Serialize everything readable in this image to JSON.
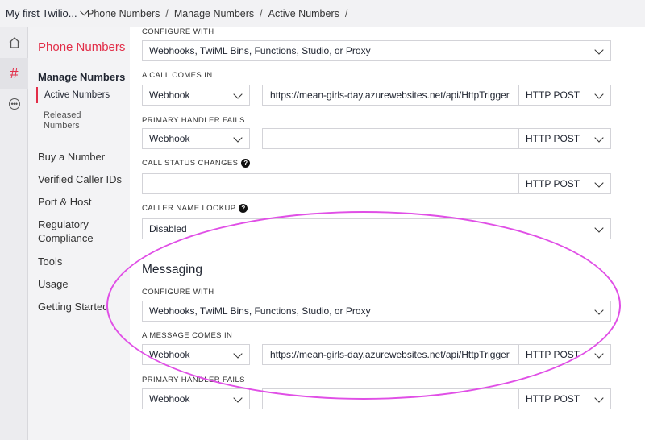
{
  "topbar": {
    "account_label": "My first Twilio...",
    "breadcrumbs": [
      "Phone Numbers",
      "Manage Numbers",
      "Active Numbers"
    ],
    "separator": "/"
  },
  "rail": {
    "icons": [
      "home-icon",
      "hash-icon",
      "more-icon"
    ]
  },
  "sidenav": {
    "title": "Phone Numbers",
    "manage": "Manage Numbers",
    "active": "Active Numbers",
    "released": "Released Numbers",
    "items": [
      "Buy a Number",
      "Verified Caller IDs",
      "Port & Host",
      "Regulatory Compliance",
      "Tools",
      "Usage",
      "Getting Started"
    ]
  },
  "voice": {
    "configure_label": "CONFIGURE WITH",
    "configure_value": "Webhooks, TwiML Bins, Functions, Studio, or Proxy",
    "call_comes_in_label": "A CALL COMES IN",
    "call_comes_in_type": "Webhook",
    "call_comes_in_url": "https://mean-girls-day.azurewebsites.net/api/HttpTrigger",
    "call_comes_in_method": "HTTP POST",
    "primary_fails_label": "PRIMARY HANDLER FAILS",
    "primary_fails_type": "Webhook",
    "primary_fails_url": "",
    "primary_fails_method": "HTTP POST",
    "status_changes_label": "CALL STATUS CHANGES",
    "status_changes_url": "",
    "status_changes_method": "HTTP POST",
    "caller_lookup_label": "CALLER NAME LOOKUP",
    "caller_lookup_value": "Disabled",
    "help_glyph": "?"
  },
  "messaging": {
    "heading": "Messaging",
    "configure_label": "CONFIGURE WITH",
    "configure_value": "Webhooks, TwiML Bins, Functions, Studio, or Proxy",
    "message_comes_in_label": "A MESSAGE COMES IN",
    "message_comes_in_type": "Webhook",
    "message_comes_in_url": "https://mean-girls-day.azurewebsites.net/api/HttpTrigger",
    "message_comes_in_method": "HTTP POST",
    "primary_fails_label": "PRIMARY HANDLER FAILS",
    "primary_fails_type": "Webhook",
    "primary_fails_url": "",
    "primary_fails_method": "HTTP POST"
  },
  "colors": {
    "accent": "#e22d48",
    "annotation": "#e04fe6"
  }
}
